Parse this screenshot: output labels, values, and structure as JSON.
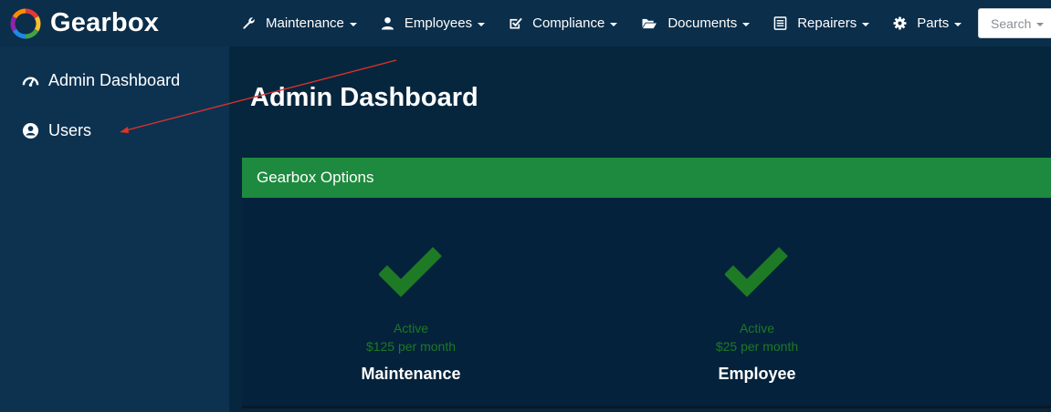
{
  "brand": {
    "name": "Gearbox"
  },
  "nav": {
    "items": [
      {
        "label": "Maintenance",
        "icon": "wrench-icon"
      },
      {
        "label": "Employees",
        "icon": "user-icon"
      },
      {
        "label": "Compliance",
        "icon": "check-square-icon"
      },
      {
        "label": "Documents",
        "icon": "folder-open-icon"
      },
      {
        "label": "Repairers",
        "icon": "list-icon"
      },
      {
        "label": "Parts",
        "icon": "gear-icon"
      }
    ],
    "search_label": "Search"
  },
  "sidebar": {
    "items": [
      {
        "label": "Admin Dashboard",
        "icon": "gauge-icon"
      },
      {
        "label": "Users",
        "icon": "user-circle-icon"
      }
    ]
  },
  "main": {
    "title": "Admin Dashboard",
    "panel": {
      "title": "Gearbox Options",
      "options": [
        {
          "status": "Active",
          "price": "$125 per month",
          "name": "Maintenance",
          "icon": "checkmark-icon"
        },
        {
          "status": "Active",
          "price": "$25 per month",
          "name": "Employee",
          "icon": "checkmark-icon"
        }
      ]
    }
  },
  "colors": {
    "navbar": "#0b2e4a",
    "sidebar": "#0d3250",
    "main": "#06263d",
    "panel_header": "#1e8a3f",
    "active_green": "#1c7a22",
    "annotation_arrow": "#e0322a"
  }
}
